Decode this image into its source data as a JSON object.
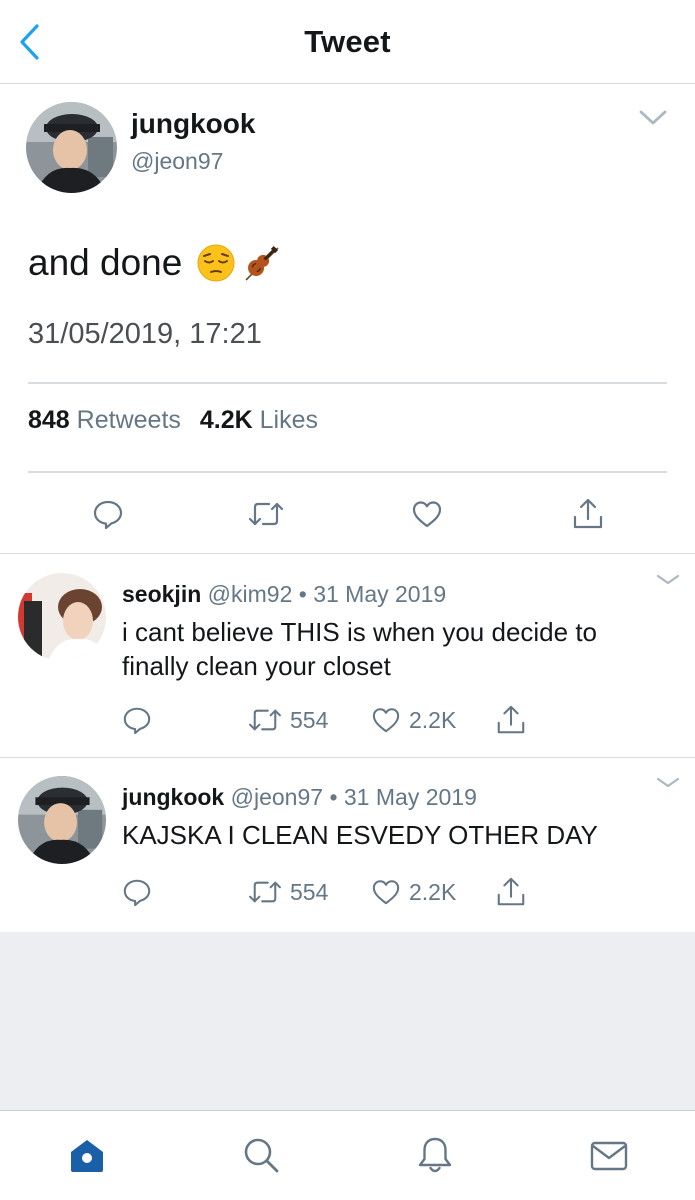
{
  "header": {
    "title": "Tweet",
    "back_icon": "chevron-left-icon"
  },
  "main_tweet": {
    "name": "jungkook",
    "handle": "@jeon97",
    "text": "and done",
    "emojis": [
      "pensive-face",
      "violin"
    ],
    "timestamp": "31/05/2019, 17:21",
    "retweets_count": "848",
    "retweets_label": "Retweets",
    "likes_count": "4.2K",
    "likes_label": "Likes",
    "actions": [
      "reply-icon",
      "retweet-icon",
      "like-icon",
      "share-icon"
    ]
  },
  "replies": [
    {
      "name": "seokjin",
      "handle": "@kim92",
      "separator": "•",
      "date": "31 May 2019",
      "text": "i cant believe THIS is when you decide to finally clean your closet",
      "retweets": "554",
      "likes": "2.2K"
    },
    {
      "name": "jungkook",
      "handle": "@jeon97",
      "separator": "•",
      "date": "31 May 2019",
      "text": "KAJSKA I CLEAN ESVEDY OTHER DAY",
      "retweets": "554",
      "likes": "2.2K"
    }
  ],
  "tabbar": {
    "items": [
      "home-icon",
      "search-icon",
      "notifications-icon",
      "messages-icon"
    ],
    "active": "home-icon"
  },
  "colors": {
    "accent": "#1da1f2",
    "tab_active": "#1b5fa8",
    "secondary_text": "#657786",
    "icon_gray": "#657786",
    "divider": "#d8dde1",
    "empty_background": "#eceef1"
  }
}
